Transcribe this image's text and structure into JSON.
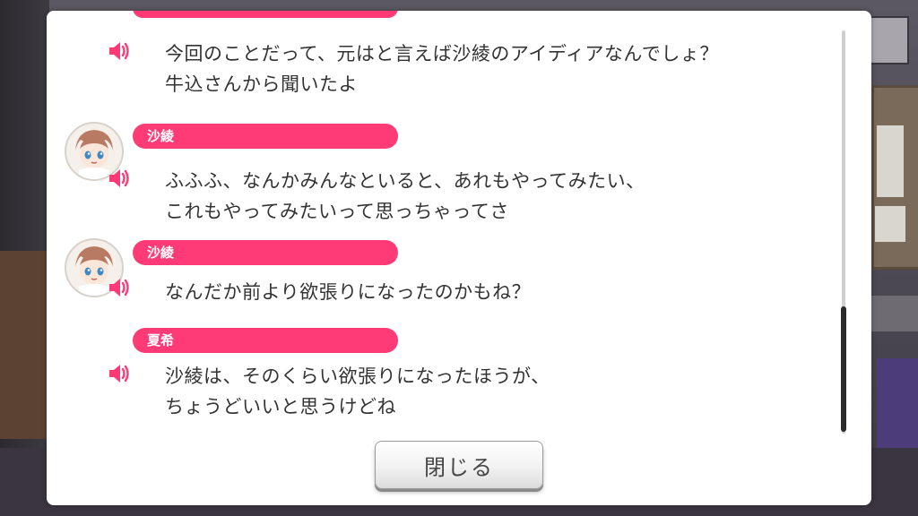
{
  "log": {
    "entries": [
      {
        "speaker": "",
        "has_avatar": false,
        "lines": [
          "今回のことだって、元はと言えば沙綾のアイディアなんでしょ？",
          "牛込さんから聞いたよ"
        ]
      },
      {
        "speaker": "沙綾",
        "has_avatar": true,
        "lines": [
          "ふふふ、なんかみんなといると、あれもやってみたい、",
          "これもやってみたいって思っちゃってさ"
        ]
      },
      {
        "speaker": "沙綾",
        "has_avatar": true,
        "lines": [
          "なんだか前より欲張りになったのかもね？"
        ]
      },
      {
        "speaker": "夏希",
        "has_avatar": false,
        "lines": [
          "沙綾は、そのくらい欲張りになったほうが、",
          "ちょうどいいと思うけどね"
        ]
      }
    ]
  },
  "close_button": {
    "label": "閉じる"
  },
  "icons": {
    "speaker": "speaker-icon",
    "avatar": "character-avatar"
  },
  "colors": {
    "name_tag": "#ff3b77",
    "speaker_icon": "#ff3b77",
    "panel_bg": "#ffffff",
    "text": "#333333"
  }
}
